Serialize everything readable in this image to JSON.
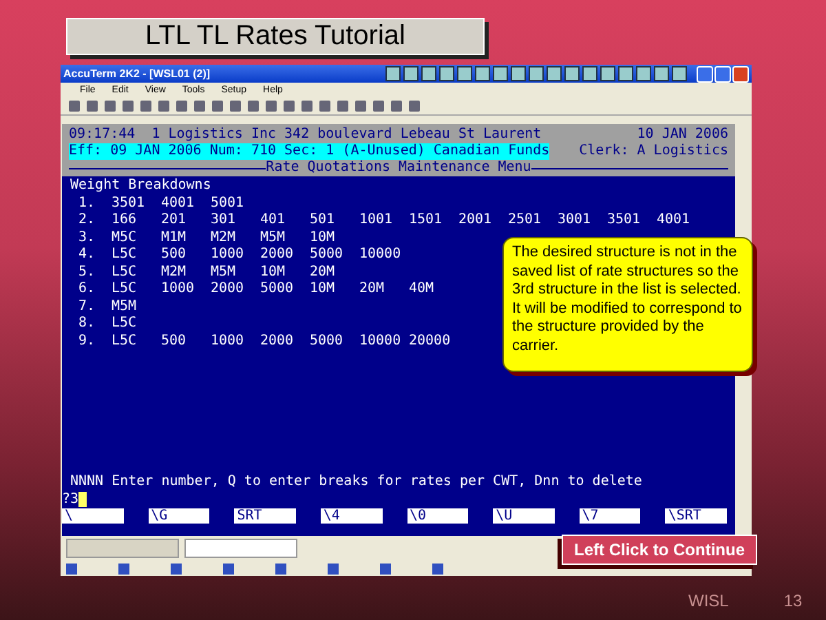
{
  "slide_title": "LTL TL Rates Tutorial",
  "window": {
    "title": "AccuTerm 2K2 - [WSL01 (2)]"
  },
  "menu": [
    "File",
    "Edit",
    "View",
    "Tools",
    "Setup",
    "Help"
  ],
  "terminal": {
    "header_line": "09:17:44  1 Logistics Inc 342 boulevard Lebeau St Laurent",
    "header_date": "10 JAN 2006",
    "status_line": "Eff: 09 JAN 2006 Num: 710 Sec: 1 (A-Unused) Canadian Funds",
    "clerk": "Clerk: A Logistics",
    "menu_title": "Rate Quotations Maintenance Menu",
    "section": "Weight Breakdowns",
    "rows": [
      {
        "num": "1.",
        "cells": [
          "3501",
          "4001",
          "5001"
        ]
      },
      {
        "num": "2.",
        "cells": [
          "166",
          "201",
          "301",
          "401",
          "501",
          "1001",
          "1501",
          "2001",
          "2501",
          "3001",
          "3501",
          "4001"
        ]
      },
      {
        "num": "3.",
        "cells": [
          "M5C",
          "M1M",
          "M2M",
          "M5M",
          "10M"
        ]
      },
      {
        "num": "4.",
        "cells": [
          "L5C",
          "500",
          "1000",
          "2000",
          "5000",
          "10000"
        ]
      },
      {
        "num": "5.",
        "cells": [
          "L5C",
          "M2M",
          "M5M",
          "10M",
          "20M"
        ]
      },
      {
        "num": "6.",
        "cells": [
          "L5C",
          "1000",
          "2000",
          "5000",
          "10M",
          "20M",
          "40M"
        ]
      },
      {
        "num": "7.",
        "cells": [
          "M5M"
        ]
      },
      {
        "num": "8.",
        "cells": [
          "L5C"
        ]
      },
      {
        "num": "9.",
        "cells": [
          "L5C",
          "500",
          "1000",
          "2000",
          "5000",
          "10000",
          "20000"
        ]
      }
    ],
    "prompt": "NNNN Enter number, Q to enter breaks for rates per CWT, Dnn to delete",
    "input": "?3",
    "function_keys": [
      "\\",
      "\\G",
      "SRT",
      "\\4",
      "\\0",
      "\\U",
      "\\7",
      "\\SRT"
    ]
  },
  "callout": "The desired structure is not in the saved list of rate structures so the 3rd structure in the list is selected. It will be modified to correspond to the structure provided by the carrier.",
  "continue_button": "Left Click to Continue",
  "footer": {
    "label": "WISL",
    "page": "13"
  }
}
